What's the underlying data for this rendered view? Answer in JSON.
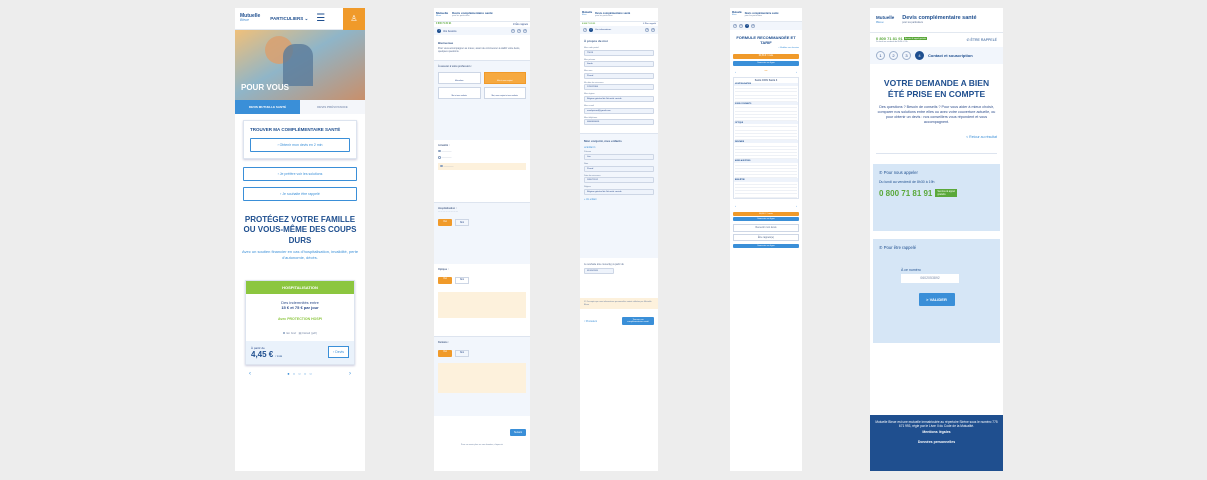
{
  "colors": {
    "accent": "#3a8fd8",
    "orange": "#f09a2a",
    "navy": "#1f4f8f",
    "green": "#8cc63f"
  },
  "logo": {
    "name": "Mutuelle",
    "sub": "Bleue"
  },
  "s1": {
    "menu": "PARTICULIERS",
    "hero_title": "POUR VOUS",
    "tab_active": "DEVIS MUTUELLE SANTÉ",
    "tab_other": "DEVIS PRÉVOYANCE",
    "find": "TROUVER MA COMPLÉMENTAIRE SANTÉ",
    "cta": "Obtenir mon devis en 2 min",
    "link1": "Je préfère voir les solutions",
    "link2": "Je souhaite être rappelé",
    "headline": "PROTÉGEZ VOTRE FAMILLE OU VOUS-MÊME DES COUPS DURS",
    "sub": "Avec un soutien financier en cas d'hospitalisation, invalidité, perte d'autonomie, décès.",
    "card_head": "HOSPITALISATION",
    "card_text": "Des indemnités entre",
    "card_range": "15 € et 75 € par jour",
    "card_product": "Avec PROTECTION HOSPI",
    "opt1": "En bref",
    "opt2": "Détail (pdf)",
    "from": "À partir de",
    "price": "4,45 €",
    "per": "/ mois",
    "devis": "Devis"
  },
  "s2": {
    "title": "Devis complémentaire santé",
    "sub": "pour les particuliers",
    "phone": "0 800 71 81 91",
    "recall": "Être rappelé",
    "step_label": "Vos besoins",
    "sec1": "Bienvenue",
    "sec1_text": "Pour vous accompagner au mieux, avant de commencer à établir votre devis, quelques questions.",
    "sec2": "À assurer à votre profession :",
    "opt_a": "Moi-même",
    "opt_b": "Moi et mon conjoint",
    "opt_c": "Moi et mes enfants",
    "opt_d": "Moi, mon conjoint et mes enfants",
    "sec3": "Actualité :",
    "q1": "Hospitalisation :",
    "q2": "Optique :",
    "q3": "Dentaire :",
    "yes": "Oui",
    "no": "Non",
    "next": "Suivant",
    "footer": "Pour en savoir plus sur vos données, cliquez ici"
  },
  "s3": {
    "title": "Devis complémentaire santé",
    "sub": "pour les particuliers",
    "phone": "0 800 71 81 91",
    "recall": "Être rappelé",
    "step_label": "Vos informations",
    "sec": "À propos de moi",
    "fields": [
      {
        "label": "Mon code postal",
        "value": "75015"
      },
      {
        "label": "Mon prénom",
        "value": "Sarah"
      },
      {
        "label": "Mon nom",
        "value": "Picard"
      },
      {
        "label": "Ma date de naissance",
        "value": "12/02/1984"
      },
      {
        "label": "Mon régime",
        "value": "Régime général de Sécurité sociale"
      },
      {
        "label": "Mon e-mail",
        "value": "sarahpicard@gmail.com"
      },
      {
        "label": "Mon téléphone",
        "value": "0606060606"
      }
    ],
    "sec2": "Mon conjoint, mes enfants",
    "child": "Enfant 1",
    "child_fields": [
      {
        "label": "Prénom",
        "value": "Léo"
      },
      {
        "label": "Nom",
        "value": "Picard"
      },
      {
        "label": "Date de naissance",
        "value": "18/07/2012"
      },
      {
        "label": "Régime",
        "value": "Régime général de Sécurité sociale"
      }
    ],
    "add": "+ Un enfant",
    "date_label": "Je souhaite être couvert(e) à partir du",
    "date": "01/05/2020",
    "consent": "J'accepte que mes informations personnelles soient utilisées par Mutuelle Bleue",
    "back": "< Précédent",
    "cta": "Trouver ma complémentaire santé"
  },
  "s4": {
    "title": "Devis complémentaire santé",
    "sub": "pour les particuliers",
    "heading": "FORMULE RECOMMANDÉE ET TARIF",
    "back_link": "< Modifier mes besoins",
    "price": "60,66 € / mois",
    "choose": "Souscrire en ligne",
    "plan": "Santé 100% Santé 3",
    "sections": [
      "HOSPITALISATION",
      "SOINS COURANTS",
      "OPTIQUE",
      "DENTAIRE",
      "AIDES AUDITIVES",
      "BIEN-ÊTRE"
    ],
    "devis": "Recevoir mon devis",
    "call": "Être rappelé(e)",
    "bottom": "Souscrire en ligne"
  },
  "s5": {
    "title": "Devis complémentaire santé",
    "sub": "pour les particuliers",
    "phone": "0 800 71 81 91",
    "free": "Service & appel gratuits",
    "hours": "Du lundi au vendredi de 8h30 à 19h",
    "recall": "ÊTRE RAPPELÉ",
    "steps": [
      "1",
      "2",
      "3",
      "4"
    ],
    "step_label": "Contact et souscription",
    "headline": "VOTRE DEMANDE A BIEN ÉTÉ PRISE EN COMPTE",
    "text": "Des questions ? Besoin de conseils ? Pour vous aider à mieux choisir, comparer nos solutions entre elles ou avec votre couverture actuelle, ou pour obtenir un devis : nos conseillers vous répondent et vous accompagnent.",
    "back": "< Retour au résultat",
    "call_title": "Pour nous appeler",
    "call_hours": "Du lundi au vendredi de 8h30 à 19h",
    "call_phone": "0 800 71 81 91",
    "call_badge": "Service & appel gratuits",
    "recall_title": "Pour être rappelé",
    "num_label": "À ce numéro",
    "num_value": "0602053892",
    "validate": "> VALIDER",
    "footer": "Mutuelle Bleue est une mutuelle immatriculée au répertoire Sirène sous le numéro 775 671 993, régie par le Livre II du Code de la Mutualité.",
    "legal": "Mentions légales",
    "privacy": "Données personnelles"
  }
}
